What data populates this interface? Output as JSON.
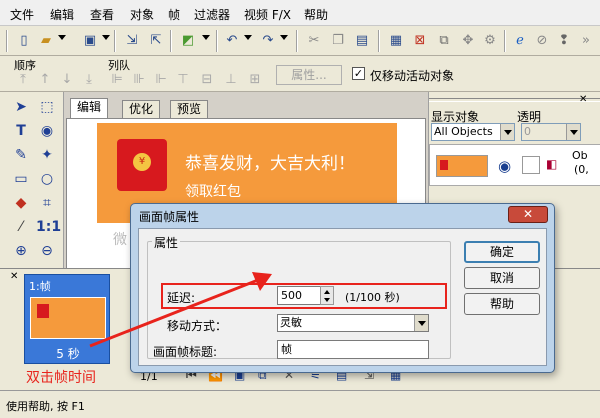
{
  "menu": {
    "items": [
      "文件",
      "编辑",
      "查看",
      "对象",
      "帧",
      "过滤器",
      "视频 F/X",
      "帮助"
    ]
  },
  "toolbar1": {
    "icons": [
      "new-file-icon",
      "open-folder-icon",
      "save-icon",
      "import-icon",
      "export-icon",
      "color-icon",
      "undo-icon",
      "redo-icon",
      "cut-icon",
      "copy-icon",
      "paste-icon",
      "frame-icon",
      "delete-icon",
      "move-icon",
      "settings-icon",
      "browser-icon",
      "stop-icon",
      "help-icon"
    ]
  },
  "toolbar2": {
    "order_label": "顺序",
    "queue_label": "列队",
    "properties_button": "属性...",
    "move_active_only_label": "仅移动活动对象",
    "move_active_only_checked": true
  },
  "tabs": [
    "编辑",
    "优化",
    "预览"
  ],
  "canvas": {
    "banner_title": "恭喜发财，大吉大利！",
    "banner_subtitle": "领取红包",
    "coin_symbol": "¥",
    "faded_text": "微",
    "banner_color": "#f59a3c",
    "packet_color": "#d7191e"
  },
  "right_panel": {
    "display_objects_label": "显示对象",
    "display_objects_value": "All Objects",
    "opacity_label": "透明",
    "opacity_value": "0",
    "object_truncated": "Ob",
    "object_coords": "(0,"
  },
  "frames": {
    "frame_label": "1:帧",
    "duration": "5 秒",
    "annotation": "双击帧时间",
    "counter": "1/1"
  },
  "status": {
    "text": "使用帮助, 按 F1"
  },
  "dialog": {
    "title": "画面帧属性",
    "close_symbol": "✕",
    "group_label": "属性",
    "delay_label": "延迟:",
    "delay_value": "500",
    "delay_unit": "(1/100 秒)",
    "move_mode_label": "移动方式：",
    "move_mode_value": "灵敏",
    "frame_title_label": "画面帧标题:",
    "frame_title_value": "帧",
    "ok_button": "确定",
    "cancel_button": "取消",
    "help_button": "帮助"
  },
  "colors": {
    "highlight": "#e8231c",
    "frame_selected": "#3a78d8"
  }
}
